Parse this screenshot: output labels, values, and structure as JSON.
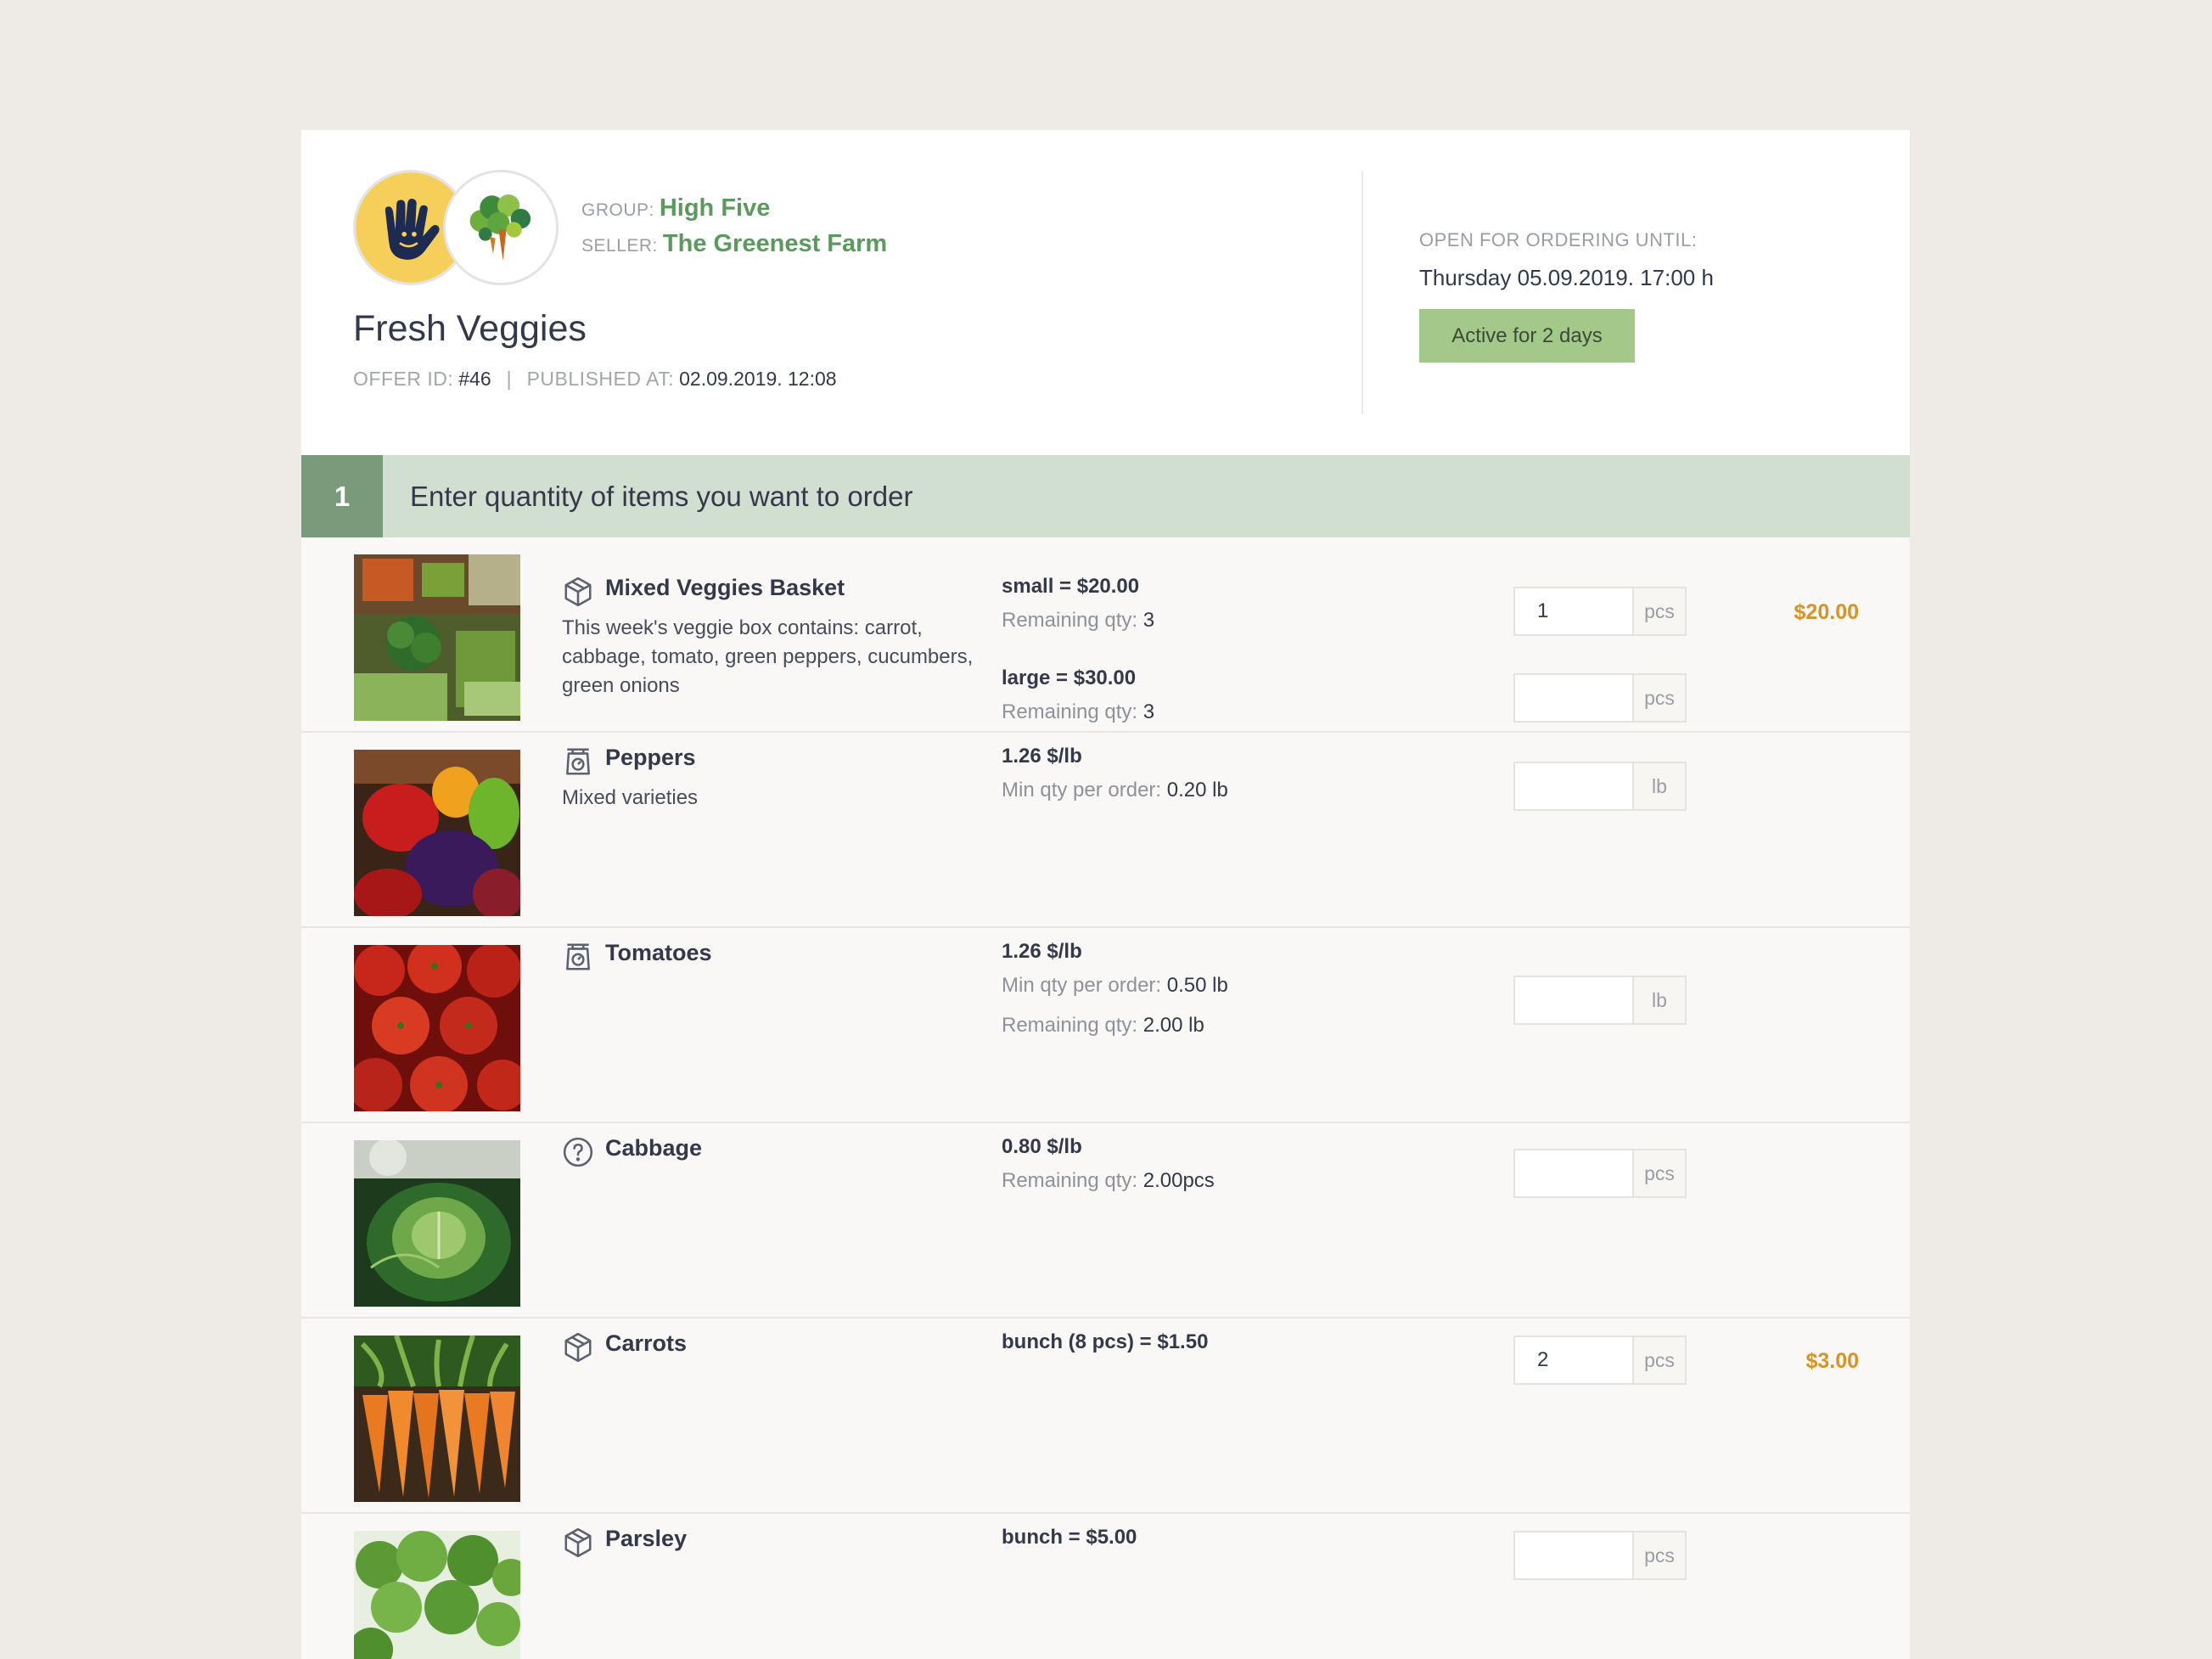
{
  "offer": {
    "group_key": "GROUP:",
    "group_name": "High Five",
    "seller_key": "SELLER:",
    "seller_name": "The Greenest Farm",
    "title": "Fresh Veggies",
    "offer_id_key": "OFFER ID:",
    "offer_id": "#46",
    "separator": "|",
    "published_key": "PUBLISHED AT:",
    "published_at": "02.09.2019. 12:08",
    "open_label": "OPEN FOR ORDERING UNTIL:",
    "open_until": "Thursday 05.09.2019. 17:00 h",
    "active_badge": "Active for 2 days"
  },
  "step": {
    "number": "1",
    "text": "Enter quantity of items you want to order"
  },
  "colors": {
    "accent_green": "#5b9a5d",
    "badge": "#a3c98a",
    "step_bar": "#d0dfcf",
    "total": "#d79326"
  },
  "products": [
    {
      "icon": "box-icon",
      "name": "Mixed Veggies Basket",
      "description": "This week's veggie box contains: carrot, cabbage, tomato, green peppers, cucumbers, green onions",
      "variants": [
        {
          "price": "small = $20.00",
          "info_label": "Remaining qty:",
          "info_value": "3",
          "qty": "1",
          "unit": "pcs",
          "total": "$20.00"
        },
        {
          "price": "large = $30.00",
          "info_label": "Remaining qty:",
          "info_value": "3",
          "qty": "",
          "unit": "pcs",
          "total": ""
        }
      ]
    },
    {
      "icon": "scale-icon",
      "name": "Peppers",
      "description": "Mixed varieties",
      "price": "1.26 $/lb",
      "info_label": "Min qty per order:",
      "info_value": "0.20 lb",
      "qty": "",
      "unit": "lb"
    },
    {
      "icon": "scale-icon",
      "name": "Tomatoes",
      "price": "1.26 $/lb",
      "info_label": "Min qty per order:",
      "info_value": "0.50 lb",
      "info2_label": "Remaining qty:",
      "info2_value": "2.00 lb",
      "qty": "",
      "unit": "lb"
    },
    {
      "icon": "question-icon",
      "name": "Cabbage",
      "price": "0.80 $/lb",
      "info_label": "Remaining qty:",
      "info_value": "2.00pcs",
      "qty": "",
      "unit": "pcs"
    },
    {
      "icon": "box-icon",
      "name": "Carrots",
      "price": "bunch (8 pcs) = $1.50",
      "qty": "2",
      "unit": "pcs",
      "total": "$3.00"
    },
    {
      "icon": "box-icon",
      "name": "Parsley",
      "price": "bunch = $5.00",
      "qty": "",
      "unit": "pcs"
    }
  ]
}
